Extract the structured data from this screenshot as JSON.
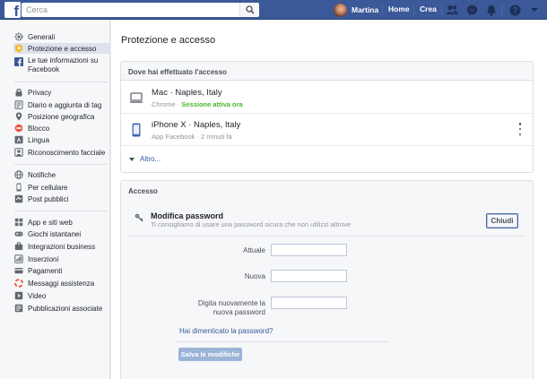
{
  "topbar": {
    "search_placeholder": "Cerca",
    "user_name": "Martina",
    "nav": [
      "Home",
      "Crea"
    ],
    "icons": [
      "friends-icon",
      "messenger-icon",
      "notifications-icon",
      "help-icon"
    ],
    "brand_color": "#3b5998"
  },
  "sidebar": {
    "groups": [
      [
        {
          "label": "Generali",
          "icon": "gear-icon"
        },
        {
          "label": "Protezione e accesso",
          "icon": "shield-icon",
          "active": true
        },
        {
          "label": "Le tue informazioni su Facebook",
          "icon": "facebook-icon"
        }
      ],
      [
        {
          "label": "Privacy",
          "icon": "lock-icon"
        },
        {
          "label": "Diario e aggiunta di tag",
          "icon": "timeline-icon"
        },
        {
          "label": "Posizione geografica",
          "icon": "location-icon"
        },
        {
          "label": "Blocco",
          "icon": "block-icon"
        },
        {
          "label": "Lingua",
          "icon": "language-icon"
        },
        {
          "label": "Riconoscimento facciale",
          "icon": "face-recognition-icon"
        }
      ],
      [
        {
          "label": "Notifiche",
          "icon": "globe-icon"
        },
        {
          "label": "Per cellulare",
          "icon": "mobile-icon"
        },
        {
          "label": "Post pubblici",
          "icon": "public-posts-icon"
        }
      ],
      [
        {
          "label": "App e siti web",
          "icon": "apps-icon"
        },
        {
          "label": "Giochi istantanei",
          "icon": "games-icon"
        },
        {
          "label": "Integrazioni business",
          "icon": "business-icon"
        },
        {
          "label": "Inserzioni",
          "icon": "ads-icon"
        },
        {
          "label": "Pagamenti",
          "icon": "payments-icon"
        },
        {
          "label": "Messaggi assistenza",
          "icon": "support-icon"
        },
        {
          "label": "Video",
          "icon": "video-icon"
        },
        {
          "label": "Pubblicazioni associate",
          "icon": "linked-publications-icon"
        }
      ]
    ]
  },
  "main": {
    "title": "Protezione e accesso",
    "login_card": {
      "header": "Dove hai effettuato l'accesso",
      "devices": [
        {
          "title": "Mac · Naples, Italy",
          "app": "Chrome · ",
          "status": "Sessione attiva ora",
          "icon": "laptop-icon"
        },
        {
          "title": "iPhone X · Naples, Italy",
          "app": "App Facebook · 2 minuti fa",
          "status": "",
          "icon": "phone-icon"
        }
      ],
      "more_label": "Altro..."
    },
    "access_card": {
      "header": "Accesso",
      "pw_title": "Modifica password",
      "pw_subtitle": "Ti consigliamo di usare una password sicura che non utilizzi altrove",
      "close_label": "Chiudi",
      "fields": [
        {
          "label": "Attuale",
          "value": ""
        },
        {
          "label": "Nuova",
          "value": ""
        },
        {
          "label_line1": "Digita nuovamente la",
          "label_line2": "nuova password",
          "value": ""
        }
      ],
      "forgot_label": "Hai dimenticato la password?",
      "save_label": "Salva le modifiche"
    }
  }
}
